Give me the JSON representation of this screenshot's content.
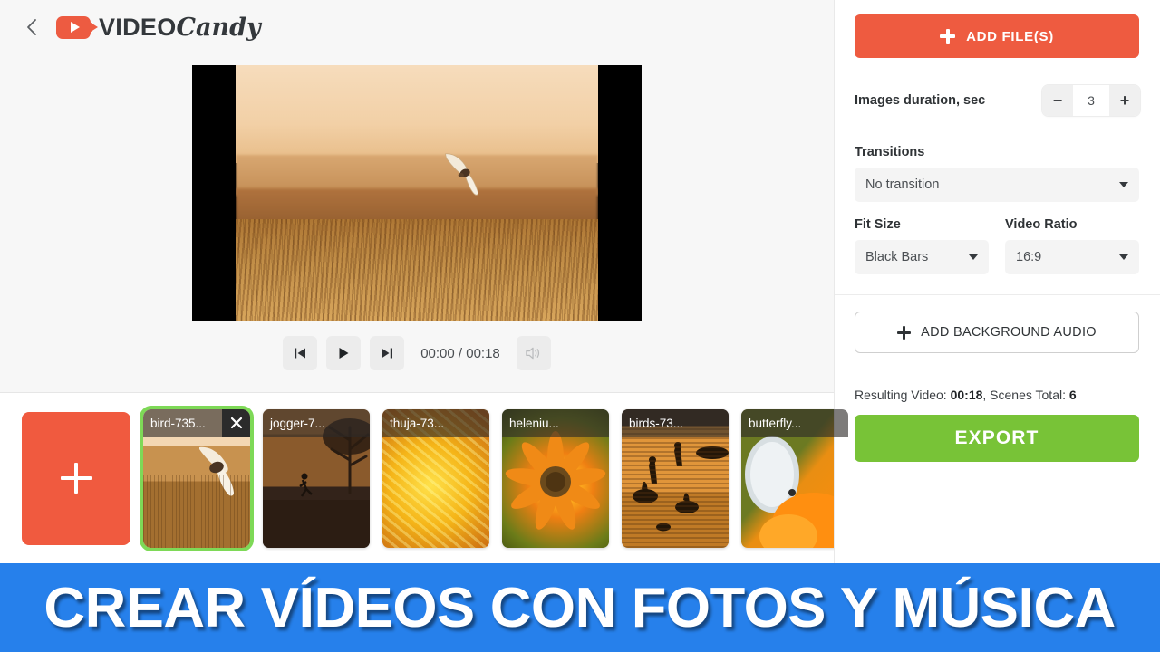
{
  "header": {
    "back_icon": "chevron-left-icon",
    "logo_icon": "video-camera-icon",
    "brand_primary": "VIDEO",
    "brand_secondary": "Candy"
  },
  "preview": {
    "fit_mode_visual": "black-bars",
    "scene_description": "bird flying over golden field"
  },
  "player": {
    "prev_icon": "skip-previous-icon",
    "play_icon": "play-icon",
    "next_icon": "skip-next-icon",
    "volume_icon": "volume-icon",
    "current_time": "00:00",
    "separator": "/",
    "total_time": "00:18",
    "time_display": "00:00 / 00:18"
  },
  "timeline": {
    "add_tile_icon": "plus-icon",
    "clips": [
      {
        "name": "bird-735...",
        "selected": true,
        "close_icon": "close-icon",
        "art": "t-bird"
      },
      {
        "name": "jogger-7...",
        "selected": false,
        "art": "t-jogger"
      },
      {
        "name": "thuja-73...",
        "selected": false,
        "art": "t-thuja"
      },
      {
        "name": "heleniu...",
        "selected": false,
        "art": "t-heleniu"
      },
      {
        "name": "birds-73...",
        "selected": false,
        "art": "t-birds"
      },
      {
        "name": "butterfly...",
        "selected": false,
        "art": "t-butterfly"
      }
    ]
  },
  "sidebar": {
    "add_files_label": "ADD FILE(S)",
    "duration": {
      "label": "Images duration, sec",
      "minus_label": "−",
      "plus_label": "+",
      "value": "3"
    },
    "transitions": {
      "label": "Transitions",
      "value": "No transition"
    },
    "fit_size": {
      "label": "Fit Size",
      "value": "Black Bars"
    },
    "video_ratio": {
      "label": "Video Ratio",
      "value": "16:9"
    },
    "add_audio_label": "ADD BACKGROUND AUDIO",
    "result": {
      "prefix": "Resulting Video: ",
      "duration": "00:18",
      "middle": ", Scenes Total: ",
      "scenes_total": "6"
    },
    "export_label": "EXPORT"
  },
  "banner": {
    "text": "CREAR VÍDEOS CON FOTOS Y MÚSICA",
    "background_color": "#2680eb"
  },
  "colors": {
    "accent_orange": "#ee5b40",
    "export_green": "#78c337",
    "selection_green": "#7ed957",
    "banner_blue": "#2680eb",
    "page_background": "#f7f7f7"
  }
}
